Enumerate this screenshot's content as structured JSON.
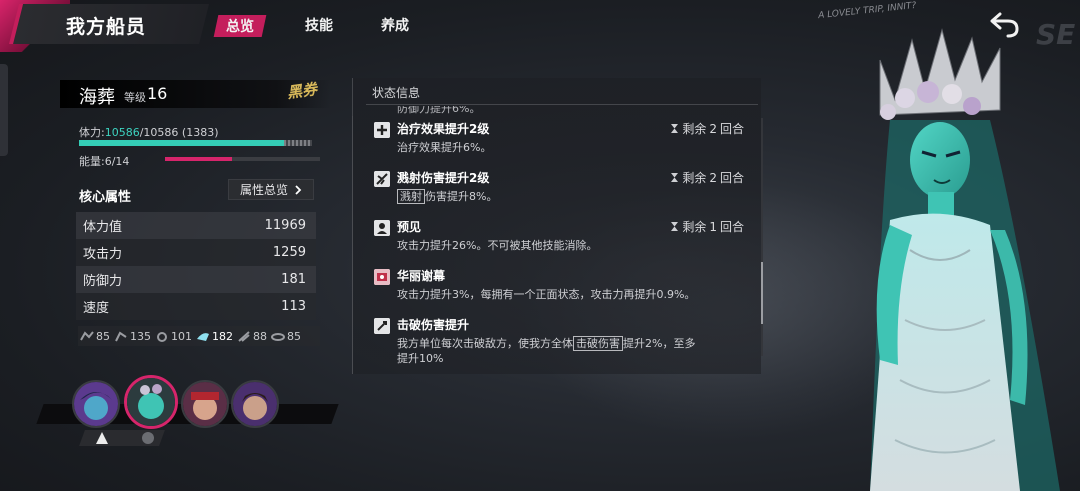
{
  "header": {
    "title": "我方船员",
    "tabs": [
      {
        "label": "总览",
        "active": true
      },
      {
        "label": "技能",
        "active": false
      },
      {
        "label": "养成",
        "active": false
      }
    ],
    "corner_scribble": "A LOVELY TRIP, INNIT?",
    "corner_big": "SE"
  },
  "character": {
    "name": "海葬",
    "level_label": "等级",
    "level": "16",
    "badge": "黑券",
    "hp_label": "体力:",
    "hp_current": "10586",
    "hp_rest": "/10586 (1383)",
    "hp_fraction": 0.88,
    "energy_text": "能量:6/14",
    "energy_fraction": 0.43
  },
  "core": {
    "title": "核心属性",
    "overview_button": "属性总览",
    "attributes": [
      {
        "label": "体力值",
        "value": "11969"
      },
      {
        "label": "攻击力",
        "value": "1259"
      },
      {
        "label": "防御力",
        "value": "181"
      },
      {
        "label": "速度",
        "value": "113"
      }
    ],
    "mini_stats": [
      {
        "icon": "mini-stat-icon-1",
        "value": "85"
      },
      {
        "icon": "mini-stat-icon-2",
        "value": "135"
      },
      {
        "icon": "mini-stat-icon-3",
        "value": "101"
      },
      {
        "icon": "mini-stat-icon-4",
        "value": "182",
        "highlight": true
      },
      {
        "icon": "mini-stat-icon-5",
        "value": "88"
      },
      {
        "icon": "mini-stat-icon-6",
        "value": "85"
      }
    ]
  },
  "status": {
    "header": "状态信息",
    "cut_top": "防御力提升6%。",
    "turns_prefix": "剩余",
    "turns_suffix": "回合",
    "items": [
      {
        "name": "治疗效果提升2级",
        "desc": "治疗效果提升6%。",
        "turns": "2",
        "leveled": true
      },
      {
        "name": "溅射伤害提升2级",
        "desc_tag": "溅射",
        "desc": "伤害提升8%。",
        "turns": "2",
        "leveled": true
      },
      {
        "name": "预见",
        "desc": "攻击力提升26%。不可被其他技能消除。",
        "turns": "1",
        "leveled": false
      },
      {
        "name": "华丽谢幕",
        "desc": "攻击力提升3%，每拥有一个正面状态，攻击力再提升0.9%。",
        "turns": "",
        "leveled": false
      },
      {
        "name": "击破伤害提升",
        "desc": "我方单位每次击破敌方，使我方全体",
        "desc_tag": "击破伤害",
        "desc_after": "提升2%，至多",
        "desc_cut": "提升10%",
        "turns": "",
        "leveled": false
      }
    ]
  },
  "colors": {
    "accent": "#c41e5c",
    "hp": "#34cdb6",
    "energy": "#d6256b",
    "character_skin": "#3fc4b4"
  }
}
